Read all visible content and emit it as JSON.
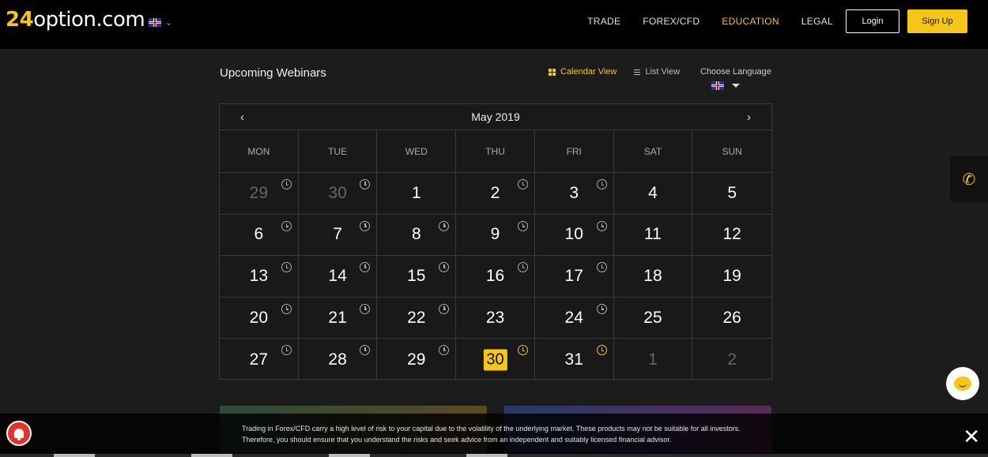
{
  "brand": {
    "logo_num": "24",
    "logo_text": "option.com"
  },
  "nav": {
    "items": [
      "TRADE",
      "FOREX/CFD",
      "EDUCATION",
      "LEGAL"
    ],
    "active_index": 2,
    "login_label": "Login",
    "signup_label": "Sign Up"
  },
  "page": {
    "title": "Upcoming Webinars",
    "calendar_view_label": "Calendar View",
    "list_view_label": "List View",
    "choose_language_label": "Choose Language"
  },
  "calendar": {
    "month": "May 2019",
    "prev_label": "‹",
    "next_label": "›",
    "weekdays": [
      "MON",
      "TUE",
      "WED",
      "THU",
      "FRI",
      "SAT",
      "SUN"
    ],
    "weeks": [
      [
        {
          "d": "29",
          "muted": true,
          "clock": true
        },
        {
          "d": "30",
          "muted": true,
          "clock": true
        },
        {
          "d": "1",
          "clock": false
        },
        {
          "d": "2",
          "clock": true
        },
        {
          "d": "3",
          "clock": true
        },
        {
          "d": "4",
          "clock": false
        },
        {
          "d": "5",
          "clock": false
        }
      ],
      [
        {
          "d": "6",
          "clock": true
        },
        {
          "d": "7",
          "clock": true
        },
        {
          "d": "8",
          "clock": true
        },
        {
          "d": "9",
          "clock": true
        },
        {
          "d": "10",
          "clock": true
        },
        {
          "d": "11",
          "clock": false
        },
        {
          "d": "12",
          "clock": false
        }
      ],
      [
        {
          "d": "13",
          "clock": true
        },
        {
          "d": "14",
          "clock": true
        },
        {
          "d": "15",
          "clock": true
        },
        {
          "d": "16",
          "clock": true
        },
        {
          "d": "17",
          "clock": true
        },
        {
          "d": "18",
          "clock": false
        },
        {
          "d": "19",
          "clock": false
        }
      ],
      [
        {
          "d": "20",
          "clock": true
        },
        {
          "d": "21",
          "clock": true
        },
        {
          "d": "22",
          "clock": true
        },
        {
          "d": "23",
          "clock": false
        },
        {
          "d": "24",
          "clock": true
        },
        {
          "d": "25",
          "clock": false
        },
        {
          "d": "26",
          "clock": false
        }
      ],
      [
        {
          "d": "27",
          "clock": true
        },
        {
          "d": "28",
          "clock": true
        },
        {
          "d": "29",
          "clock": true
        },
        {
          "d": "30",
          "clock": true,
          "today": true,
          "gold": true
        },
        {
          "d": "31",
          "clock": true,
          "gold": true
        },
        {
          "d": "1",
          "muted": true,
          "clock": false
        },
        {
          "d": "2",
          "muted": true,
          "clock": false
        }
      ]
    ]
  },
  "risk_banner": {
    "text": "Trading in Forex/CFD carry a high level of risk to your capital due to the volatility of the underlying market. These products may not be suitable for all investors. Therefore, you should ensure that you understand the risks and seek advice from an independent and suitably licensed financial advisor.",
    "close_label": "✕"
  },
  "colors": {
    "accent": "#f5c518",
    "background": "#1c1c1c",
    "topbar": "#000000",
    "alert": "#e0342c"
  }
}
